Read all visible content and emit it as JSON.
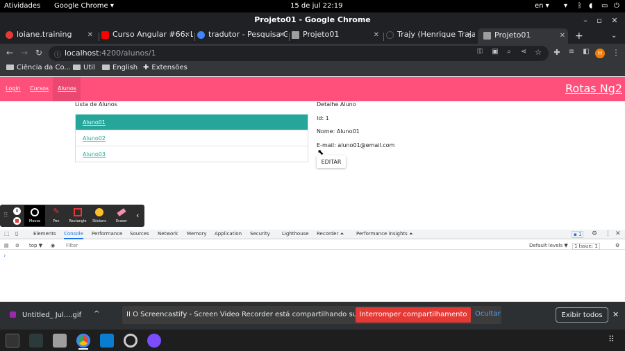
{
  "system": {
    "activities": "Atividades",
    "app_menu": "Google Chrome ▾",
    "clock": "15 de jul  22:19",
    "lang": "en ▾"
  },
  "window": {
    "title": "Projeto01 - Google Chrome"
  },
  "tabs": [
    {
      "label": "loiane.training"
    },
    {
      "label": "Curso Angular #66: L"
    },
    {
      "label": "tradutor - Pesquisa G"
    },
    {
      "label": "Projeto01"
    },
    {
      "label": "Trajy (Henrique Traja"
    },
    {
      "label": "Projeto01"
    }
  ],
  "address": {
    "host": "localhost",
    "path": ":4200/alunos/1"
  },
  "bookmarks": [
    {
      "label": "Ciência da Co..."
    },
    {
      "label": "Util"
    },
    {
      "label": "English"
    },
    {
      "label": "Extensões"
    }
  ],
  "profile_initial": "H",
  "app": {
    "nav": [
      "Login",
      "Cursos",
      "Alunos"
    ],
    "brand": "Rotas Ng2",
    "list_title": "Lista de Alunos",
    "students": [
      "Aluno01",
      "Aluno02",
      "Aluno03"
    ],
    "detail_title": "Detalhe Aluno",
    "detail_id": "Id: 1",
    "detail_name": "Nome: Aluno01",
    "detail_email": "E-mail: aluno01@email.com",
    "edit_label": "EDITAR"
  },
  "screencastify_tools": [
    "Mouse",
    "Pen",
    "Rectangle",
    "Stickers",
    "Eraser"
  ],
  "devtools": {
    "tabs": [
      "Elements",
      "Console",
      "Performance",
      "Sources",
      "Network",
      "Memory",
      "Application",
      "Security",
      "Lighthouse",
      "Recorder ⏶",
      "Performance insights ⏶"
    ],
    "issues_badge": "1",
    "context": "top ▼",
    "filter_placeholder": "Filter",
    "levels": "Default levels ▼",
    "issue_count": "1 Issue:  1",
    "prompt": "›"
  },
  "download": {
    "file": "Untitled_ Jul....gif"
  },
  "sharing": {
    "message": "II  O Screencastify - Screen Video Recorder está compartilhando sua tela.",
    "stop": "Interromper compartilhamento",
    "hide": "Ocultar",
    "show_all": "Exibir todos"
  },
  "colors": {
    "navbar": "#ff4f7b",
    "accent": "#26a69a",
    "stop": "#e53935"
  }
}
